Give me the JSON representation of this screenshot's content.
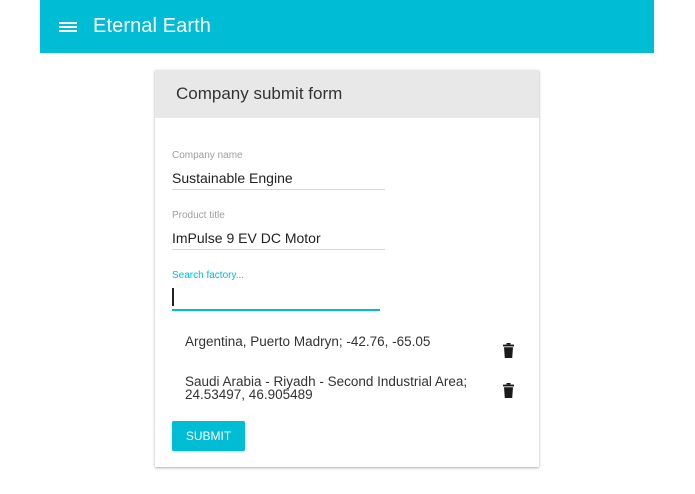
{
  "app": {
    "title": "Eternal Earth",
    "brand_color": "#00bcd4"
  },
  "form": {
    "title": "Company submit form",
    "company_name": {
      "label": "Company name",
      "value": "Sustainable Engine"
    },
    "product_title": {
      "label": "Product title",
      "value": "ImPulse 9 EV DC Motor"
    },
    "search": {
      "label": "Search factory...",
      "value": ""
    },
    "factories": [
      {
        "line1": "Argentina, Puerto Madryn; -42.76, -65.05",
        "line2": ""
      },
      {
        "line1": "Saudi Arabia - Riyadh - Second Industrial Area;",
        "line2": "24.53497, 46.905489"
      }
    ],
    "submit_label": "SUBMIT"
  }
}
